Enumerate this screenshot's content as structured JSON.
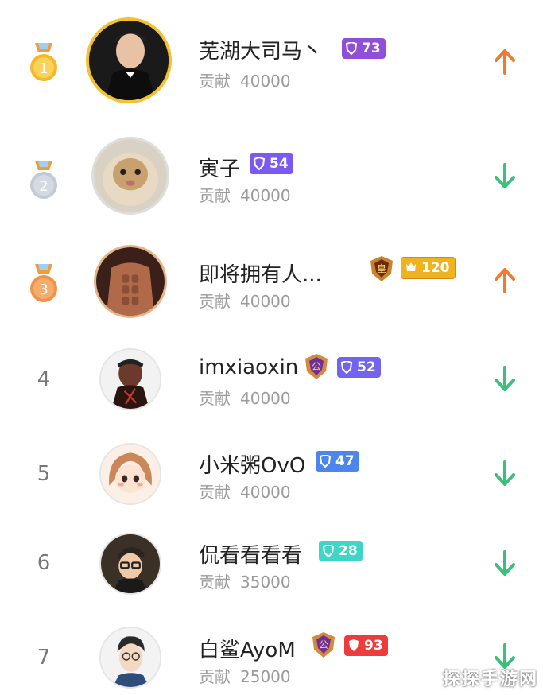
{
  "leaderboard": {
    "contribution_label": "贡献",
    "rows": [
      {
        "rank": "1",
        "name": "芜湖大司马丶",
        "contribution": "40000",
        "level": "73",
        "level_color": "#8f4fd8",
        "trend": "up"
      },
      {
        "rank": "2",
        "name": "寅子",
        "contribution": "40000",
        "level": "54",
        "level_color": "#7a5af0",
        "trend": "down"
      },
      {
        "rank": "3",
        "name": "即将拥有人...",
        "contribution": "40000",
        "level": "120",
        "level_color": "#f0b320",
        "trend": "up"
      },
      {
        "rank": "4",
        "name": "imxiaoxin",
        "contribution": "40000",
        "level": "52",
        "level_color": "#7264ee",
        "trend": "down"
      },
      {
        "rank": "5",
        "name": "小米粥OvO",
        "contribution": "40000",
        "level": "47",
        "level_color": "#4a86ee",
        "trend": "down"
      },
      {
        "rank": "6",
        "name": "侃看看看看",
        "contribution": "35000",
        "level": "28",
        "level_color": "#3fd6c8",
        "trend": "down"
      },
      {
        "rank": "7",
        "name": "白鲨AyoM",
        "contribution": "25000",
        "level": "93",
        "level_color": "#ee3b3b",
        "trend": "down"
      }
    ]
  },
  "colors": {
    "up": "#f07a2e",
    "down": "#3cbf7a",
    "gold": "#f5b829",
    "silver": "#c3cad3",
    "bronze": "#f0934a"
  },
  "watermark": "探探手游网"
}
